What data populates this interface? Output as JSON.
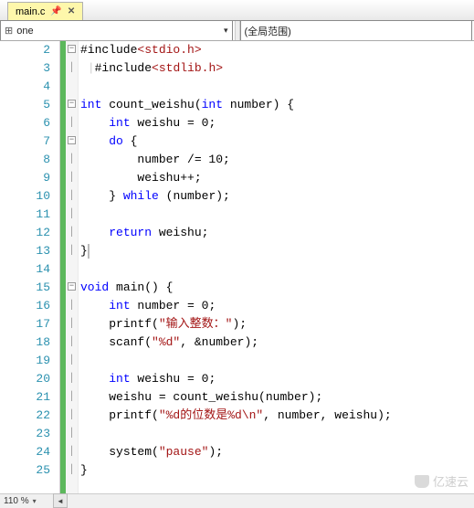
{
  "tab": {
    "filename": "main.c",
    "pin_glyph": "📌",
    "close_glyph": "✕"
  },
  "toolbar": {
    "nav_left": {
      "icon_glyph": "⊞",
      "label": "one"
    },
    "nav_right": {
      "label": "(全局范围)"
    }
  },
  "gutter": {
    "lines": [
      "2",
      "3",
      "4",
      "5",
      "6",
      "7",
      "8",
      "9",
      "10",
      "11",
      "12",
      "13",
      "14",
      "15",
      "16",
      "17",
      "18",
      "19",
      "20",
      "21",
      "22",
      "23",
      "24",
      "25"
    ]
  },
  "fold": {
    "box_minus": "−",
    "pipe": "│"
  },
  "code": {
    "l2": {
      "a": "#include",
      "b": "<stdio.h>"
    },
    "l3": {
      "a": "#include",
      "b": "<stdlib.h>"
    },
    "l5": {
      "k1": "int",
      "fn": " count_weishu(",
      "k2": "int",
      "arg": " number) {"
    },
    "l6": {
      "k": "int",
      "rest": " weishu = 0;"
    },
    "l7": {
      "k": "do",
      "rest": " {"
    },
    "l8": {
      "txt": "number /= 10;"
    },
    "l9": {
      "txt": "weishu++;"
    },
    "l10": {
      "a": "} ",
      "k": "while",
      "b": " (number);"
    },
    "l12": {
      "k": "return",
      "rest": " weishu;"
    },
    "l13": {
      "txt": "}"
    },
    "l15": {
      "k1": "void",
      "fn": " main() {"
    },
    "l16": {
      "k": "int",
      "rest": " number = 0;"
    },
    "l17": {
      "fn": "printf(",
      "s": "\"输入整数：\"",
      "rest": ");"
    },
    "l18": {
      "fn": "scanf(",
      "s": "\"%d\"",
      "rest": ", &number);"
    },
    "l20": {
      "k": "int",
      "rest": " weishu = 0;"
    },
    "l21": {
      "txt": "weishu = count_weishu(number);"
    },
    "l22": {
      "fn": "printf(",
      "s": "\"%d的位数是%d\\n\"",
      "rest": ", number, weishu);"
    },
    "l24": {
      "fn": "system(",
      "s": "\"pause\"",
      "rest": ");"
    },
    "l25": {
      "txt": "}"
    }
  },
  "status": {
    "zoom": "110 %"
  },
  "watermark": {
    "text": "亿速云"
  }
}
